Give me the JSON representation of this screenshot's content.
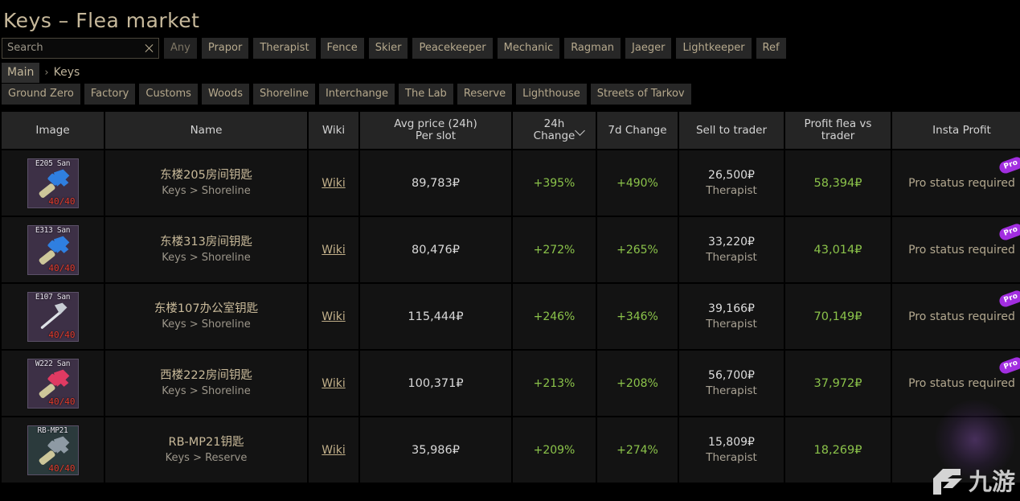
{
  "header": {
    "title": "Keys – Flea market"
  },
  "search": {
    "placeholder": "Search",
    "value": "",
    "clear_icon": "close-icon"
  },
  "trader_filters": [
    {
      "label": "Any",
      "active": false
    },
    {
      "label": "Prapor",
      "active": false
    },
    {
      "label": "Therapist",
      "active": false
    },
    {
      "label": "Fence",
      "active": false
    },
    {
      "label": "Skier",
      "active": false
    },
    {
      "label": "Peacekeeper",
      "active": false
    },
    {
      "label": "Mechanic",
      "active": false
    },
    {
      "label": "Ragman",
      "active": false
    },
    {
      "label": "Jaeger",
      "active": false
    },
    {
      "label": "Lightkeeper",
      "active": false
    },
    {
      "label": "Ref",
      "active": false
    }
  ],
  "breadcrumb": {
    "root": "Main",
    "separator": "›",
    "current": "Keys"
  },
  "map_filters": [
    {
      "label": "Ground Zero"
    },
    {
      "label": "Factory"
    },
    {
      "label": "Customs"
    },
    {
      "label": "Woods"
    },
    {
      "label": "Shoreline"
    },
    {
      "label": "Interchange"
    },
    {
      "label": "The Lab"
    },
    {
      "label": "Reserve"
    },
    {
      "label": "Lighthouse"
    },
    {
      "label": "Streets of Tarkov"
    }
  ],
  "table": {
    "columns": [
      {
        "label": "Image",
        "sub": ""
      },
      {
        "label": "Name",
        "sub": ""
      },
      {
        "label": "Wiki",
        "sub": ""
      },
      {
        "label": "Avg price (24h)",
        "sub": "Per slot"
      },
      {
        "label": "24h",
        "sub": "Change",
        "sorted": true,
        "sort_icon": "chevron-down-icon"
      },
      {
        "label": "7d Change",
        "sub": ""
      },
      {
        "label": "Sell to trader",
        "sub": ""
      },
      {
        "label": "Profit flea vs",
        "sub": "trader"
      },
      {
        "label": "Insta Profit",
        "sub": ""
      }
    ],
    "rows": [
      {
        "image": {
          "label": "E205 San",
          "count": "40/40",
          "key_color": "#2f7fe0",
          "shaft_color": "#cdc79a",
          "bg": "#3d3046",
          "type": "wide"
        },
        "name": "东楼205房间钥匙",
        "path": "Keys > Shoreline",
        "wiki": "Wiki",
        "avg_price": "89,783₽",
        "change_24h": "+395%",
        "change_7d": "+490%",
        "trader_price": "26,500₽",
        "trader_name": "Therapist",
        "profit_flea": "58,394₽",
        "insta_profit": "Pro status required",
        "pro_badge": "Pro"
      },
      {
        "image": {
          "label": "E313 San",
          "count": "40/40",
          "key_color": "#2f7fe0",
          "shaft_color": "#cdc79a",
          "bg": "#3d3046",
          "type": "wide"
        },
        "name": "东楼313房间钥匙",
        "path": "Keys > Shoreline",
        "wiki": "Wiki",
        "avg_price": "80,476₽",
        "change_24h": "+272%",
        "change_7d": "+265%",
        "trader_price": "33,220₽",
        "trader_name": "Therapist",
        "profit_flea": "43,014₽",
        "insta_profit": "Pro status required",
        "pro_badge": "Pro"
      },
      {
        "image": {
          "label": "E107 San",
          "count": "40/40",
          "key_color": "#c8cdd4",
          "shaft_color": "#dfe3e8",
          "bg": "#3d3046",
          "type": "thin"
        },
        "name": "东楼107办公室钥匙",
        "path": "Keys > Shoreline",
        "wiki": "Wiki",
        "avg_price": "115,444₽",
        "change_24h": "+246%",
        "change_7d": "+346%",
        "trader_price": "39,166₽",
        "trader_name": "Therapist",
        "profit_flea": "70,149₽",
        "insta_profit": "Pro status required",
        "pro_badge": "Pro"
      },
      {
        "image": {
          "label": "W222 San",
          "count": "40/40",
          "key_color": "#e03a62",
          "shaft_color": "#cdc79a",
          "bg": "#3d3046",
          "type": "wide"
        },
        "name": "西楼222房间钥匙",
        "path": "Keys > Shoreline",
        "wiki": "Wiki",
        "avg_price": "100,371₽",
        "change_24h": "+213%",
        "change_7d": "+208%",
        "trader_price": "56,700₽",
        "trader_name": "Therapist",
        "profit_flea": "37,972₽",
        "insta_profit": "Pro status required",
        "pro_badge": "Pro"
      },
      {
        "image": {
          "label": "RB-MP21",
          "count": "40/40",
          "key_color": "#8e9aa4",
          "shaft_color": "#cdc79a",
          "bg": "#2b3a3c",
          "type": "wide"
        },
        "name": "RB-MP21钥匙",
        "path": "Keys > Reserve",
        "wiki": "Wiki",
        "avg_price": "35,986₽",
        "change_24h": "+209%",
        "change_7d": "+274%",
        "trader_price": "15,809₽",
        "trader_name": "Therapist",
        "profit_flea": "18,269₽",
        "insta_profit": "",
        "pro_badge": ""
      }
    ]
  },
  "watermark": {
    "text": "九游",
    "logo_icon": "jiuyou-logo-icon"
  },
  "colors": {
    "accent_gold": "#c7b99b",
    "positive_green": "#8bc34a",
    "pro_purple": "#a22ee0",
    "count_red": "#e03a2a"
  }
}
